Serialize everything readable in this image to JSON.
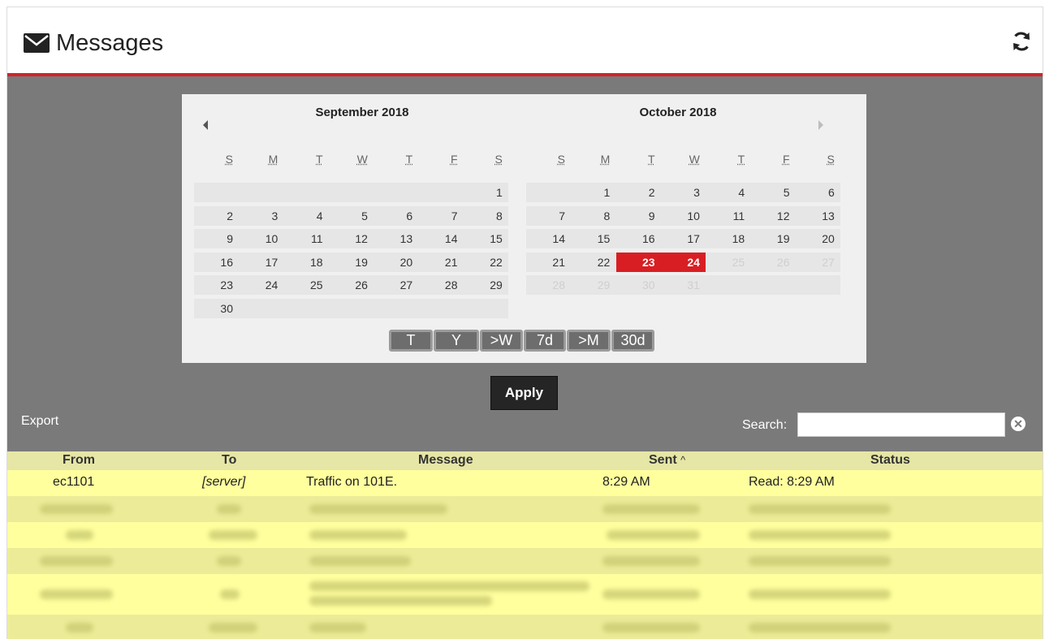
{
  "header": {
    "title": "Messages",
    "icon": "envelope-icon",
    "refresh_icon": "refresh-icon"
  },
  "calendar": {
    "left_month": "September  2018",
    "right_month": "October  2018",
    "weekdays": [
      "S",
      "M",
      "T",
      "W",
      "T",
      "F",
      "S"
    ],
    "september_weeks": [
      [
        "",
        "",
        "",
        "",
        "",
        "",
        "1"
      ],
      [
        "2",
        "3",
        "4",
        "5",
        "6",
        "7",
        "8"
      ],
      [
        "9",
        "10",
        "11",
        "12",
        "13",
        "14",
        "15"
      ],
      [
        "16",
        "17",
        "18",
        "19",
        "20",
        "21",
        "22"
      ],
      [
        "23",
        "24",
        "25",
        "26",
        "27",
        "28",
        "29"
      ],
      [
        "30",
        "",
        "",
        "",
        "",
        "",
        ""
      ]
    ],
    "october_weeks": [
      [
        "",
        "1",
        "2",
        "3",
        "4",
        "5",
        "6"
      ],
      [
        "7",
        "8",
        "9",
        "10",
        "11",
        "12",
        "13"
      ],
      [
        "14",
        "15",
        "16",
        "17",
        "18",
        "19",
        "20"
      ],
      [
        "21",
        "22",
        "23",
        "24",
        "25",
        "26",
        "27"
      ],
      [
        "28",
        "29",
        "30",
        "31",
        "",
        "",
        ""
      ]
    ],
    "selected_days": [
      "23",
      "24"
    ],
    "quick_buttons": [
      "T",
      "Y",
      ">W",
      "7d",
      ">M",
      "30d"
    ]
  },
  "actions": {
    "apply_label": "Apply",
    "export_label": "Export",
    "search_label": "Search:",
    "search_value": "",
    "clear_icon": "clear-icon"
  },
  "table": {
    "columns": [
      "From",
      "To",
      "Message",
      "Sent",
      "Status"
    ],
    "sort_indicator": "^",
    "rows": [
      {
        "from": "ec1101",
        "to": "[server]",
        "message": "Traffic on 101E.",
        "sent": "8:29 AM",
        "status": "Read: 8:29 AM"
      }
    ]
  },
  "colors": {
    "accent": "#d32329",
    "filter_bg": "#7a7a7a",
    "header_row": "#e6e6a6",
    "row_odd": "#ffff9e",
    "row_even": "#ecec98"
  }
}
